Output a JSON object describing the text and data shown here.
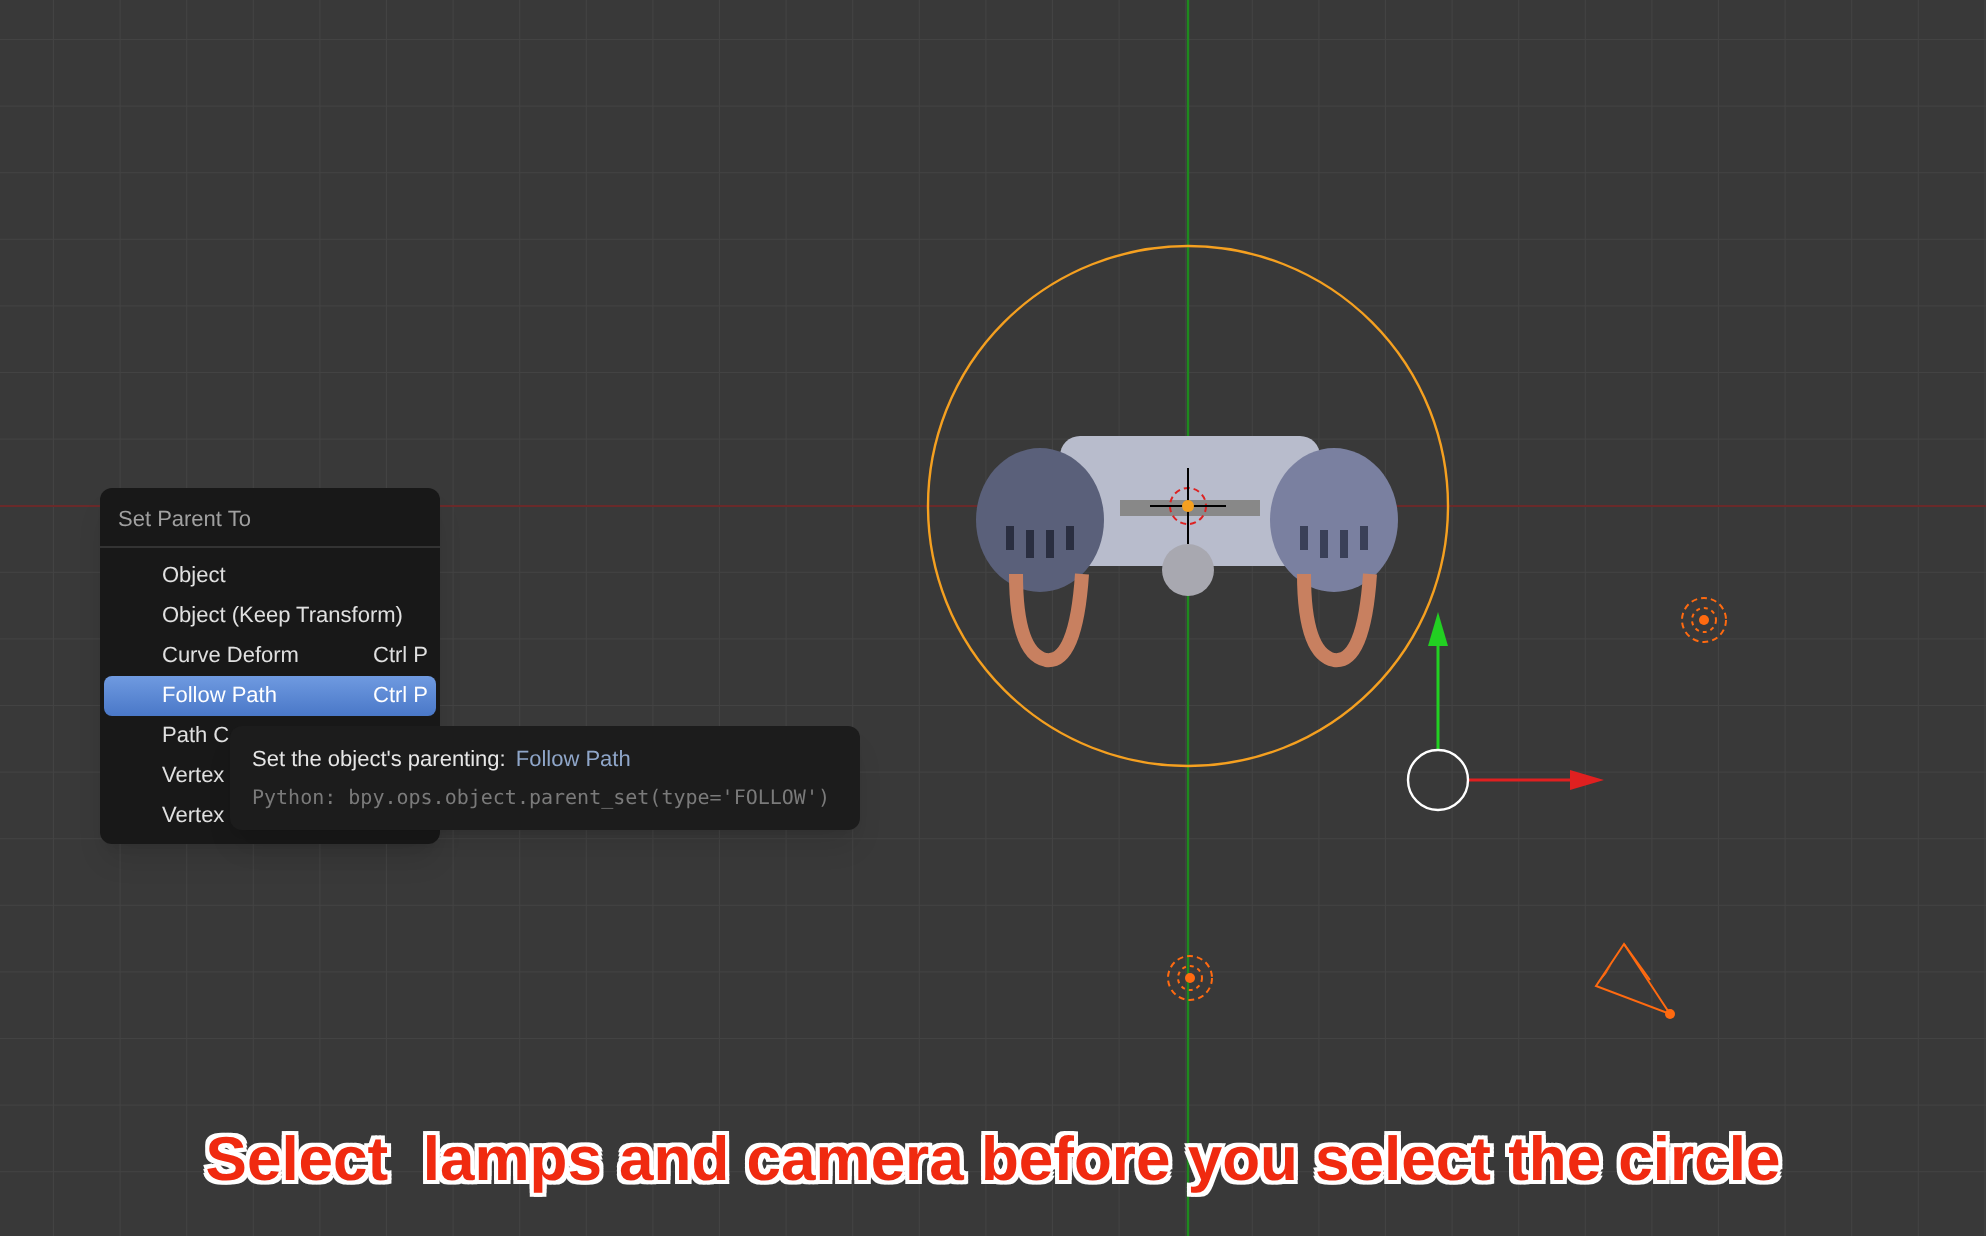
{
  "menu": {
    "title": "Set Parent To",
    "items": [
      {
        "label": "Object",
        "selected": false
      },
      {
        "label": "Object (Keep Transform)",
        "selected": false
      },
      {
        "label": "Curve Deform",
        "shortcut": "Ctrl P",
        "selected": false
      },
      {
        "label": "Follow Path",
        "shortcut": "Ctrl P",
        "selected": true
      },
      {
        "label": "Path C",
        "selected": false
      },
      {
        "label": "Vertex",
        "selected": false
      },
      {
        "label": "Vertex",
        "selected": false
      }
    ]
  },
  "tooltip": {
    "description": "Set the object's parenting:",
    "value": "Follow Path",
    "python": "Python: bpy.ops.object.parent_set(type='FOLLOW')"
  },
  "caption": "Select  lamps and camera before you select the circle"
}
